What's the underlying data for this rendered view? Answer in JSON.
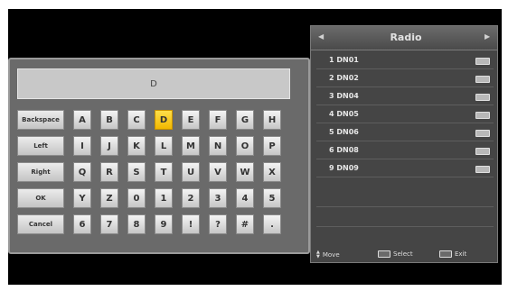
{
  "keyboard": {
    "display_value": "D",
    "function_keys": [
      "Backspace",
      "Left",
      "Right",
      "OK",
      "Cancel"
    ],
    "rows": [
      [
        "A",
        "B",
        "C",
        "D",
        "E",
        "F",
        "G",
        "H"
      ],
      [
        "I",
        "J",
        "K",
        "L",
        "M",
        "N",
        "O",
        "P"
      ],
      [
        "Q",
        "R",
        "S",
        "T",
        "U",
        "V",
        "W",
        "X"
      ],
      [
        "Y",
        "Z",
        "0",
        "1",
        "2",
        "3",
        "4",
        "5"
      ],
      [
        "6",
        "7",
        "8",
        "9",
        "!",
        "?",
        "#",
        "."
      ]
    ],
    "selected_key": "D"
  },
  "radio": {
    "title": "Radio",
    "channels": [
      {
        "label": "1 DN01"
      },
      {
        "label": "2 DN02"
      },
      {
        "label": "3 DN04"
      },
      {
        "label": "4 DN05"
      },
      {
        "label": "5 DN06"
      },
      {
        "label": "6 DN08"
      },
      {
        "label": "9 DN09"
      }
    ],
    "footer": {
      "move_label": "Move",
      "select_label": "Select",
      "exit_label": "Exit"
    }
  },
  "colors": {
    "selected_key": "#f5c400",
    "panel_bg": "#6a6a6a",
    "list_bg": "#454545"
  }
}
